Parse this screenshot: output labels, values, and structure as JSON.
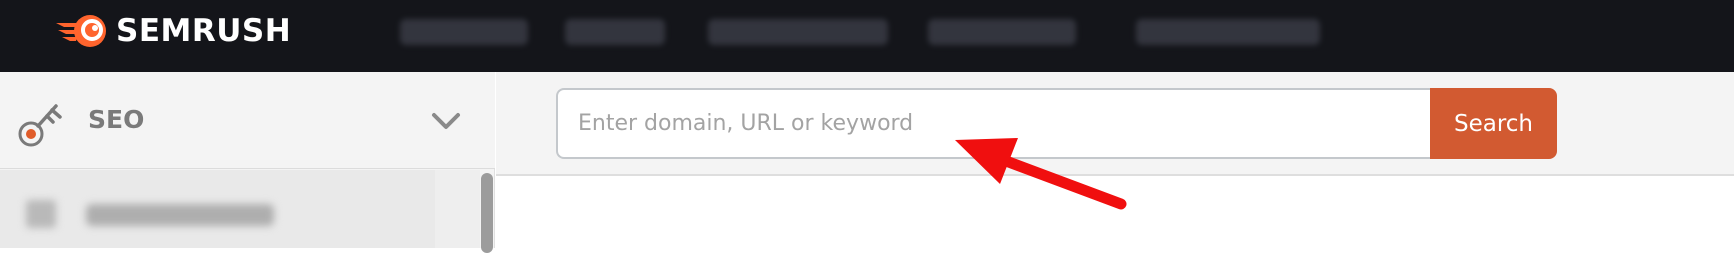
{
  "header": {
    "logo_text": "SEMRUSH"
  },
  "sidebar": {
    "section_label": "SEO"
  },
  "search": {
    "placeholder": "Enter domain, URL or keyword",
    "button_label": "Search"
  },
  "colors": {
    "topbar": "#14151a",
    "brand_orange": "#ff642d",
    "search_button": "#d25a31",
    "arrow": "#f00f0f"
  },
  "icons": {
    "logo": "fireball-icon",
    "seo": "key-icon",
    "collapse": "chevron-down-icon",
    "annotation": "red-arrow"
  }
}
